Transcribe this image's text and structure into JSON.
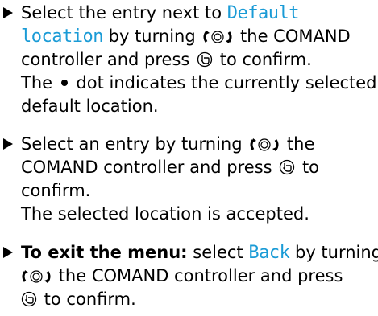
{
  "steps": [
    {
      "lines": [
        {
          "text1": "Select the entry next to ",
          "display": "Default"
        },
        {
          "display": "location",
          "text1": " by turning ",
          "text2": " the COMAND"
        },
        {
          "text1": "controller and press ",
          "text2": " to confirm."
        },
        {
          "text1": "The ",
          "text2": " dot indicates the currently selected"
        },
        {
          "text1": "default location."
        }
      ]
    },
    {
      "lines": [
        {
          "text1": "Select an entry by turning ",
          "text2": " the"
        },
        {
          "text1": "COMAND controller and press ",
          "text2": " to"
        },
        {
          "text1": "confirm."
        },
        {
          "text1": "The selected location is accepted."
        }
      ]
    },
    {
      "lines": [
        {
          "bold": "To exit the menu:",
          "text1": " select ",
          "display": "Back",
          "text2": " by turning"
        },
        {
          "text1": " the COMAND controller and press"
        },
        {
          "text1": " to confirm."
        }
      ]
    }
  ],
  "icons": {
    "bullet": "triangle-bullet-icon",
    "turn": "controller-turn-icon",
    "press": "controller-press-icon",
    "dot": "selection-dot-icon"
  },
  "colors": {
    "display_text": "#1a9bd6",
    "text": "#000000"
  }
}
